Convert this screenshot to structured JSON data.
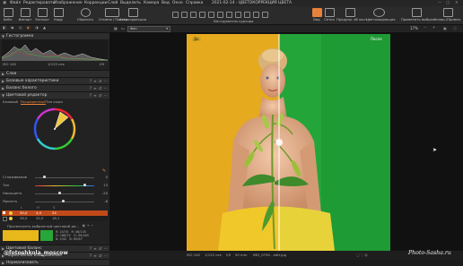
{
  "menubar": {
    "items": [
      "Файл",
      "Редактировать",
      "Изображение",
      "Коррекции",
      "Слой",
      "Выделить",
      "Камера",
      "Вид",
      "Окно",
      "Справка"
    ],
    "filename": "2021-02-14 - ЦВЕТОКОРРЕКЦИЯ ЦВЕТА"
  },
  "toolbar": {
    "left_buttons": [
      "Библ.",
      "Импорт",
      "Экспорт",
      "Кадр"
    ],
    "reset_label": "Сбросить",
    "undo_redo_label": "Отмена / Повтор",
    "auto_label": "Автокоррекция",
    "cursor_tools_label": "Инструменты курсора",
    "right_buttons": [
      "Вид",
      "Сетка",
      "Предупр. об эксп.",
      "Цветокоррекция"
    ],
    "apply_label": "Применить выбран.",
    "copy_label": "Копир./Примен."
  },
  "left_panel": {
    "histogram_title": "Гистограмма",
    "exif": {
      "iso": "ISO 100",
      "shutter": "1/125 сек",
      "aperture": "f/9"
    },
    "sections": [
      "Слои",
      "Базовые характеристики",
      "Баланс белого",
      "Цветовой редактор"
    ],
    "color_editor_tabs": [
      "Базовый",
      "Расширенный",
      "Тон кожи"
    ],
    "active_tab": "Расширенный",
    "sliders": [
      {
        "label": "Сглаживание",
        "value": "0",
        "pos": 0.15
      },
      {
        "label": "Тон",
        "value": "13",
        "pos": 0.82
      },
      {
        "label": "Насыщенн.",
        "value": "-20",
        "pos": 0.4
      },
      {
        "label": "Яркость",
        "value": "-6",
        "pos": 0.45
      }
    ],
    "table_header": [
      "",
      "L",
      "H",
      "S",
      "L"
    ],
    "table_rows": [
      {
        "c1": "30,0",
        "c2": "4,0",
        "c3": "24"
      },
      {
        "c1": "36,0",
        "c2": "32,0",
        "c3": "18,1"
      }
    ],
    "preview_label": "Просмотреть выбранный цветовой ди...",
    "readout": {
      "l1": "R:",
      "l1v": "247/0",
      "l2": "G:",
      "l2v": "186/72",
      "l3": "B:",
      "l3v": "2/42",
      "r1": "R:",
      "r1v": "46/135",
      "r2": "G:",
      "r2v": "99/160",
      "r3": "B:",
      "r3v": "65/67"
    },
    "bottom_sections": [
      "Цветовой баланс",
      "Черно-белое изображение",
      "Нормализовать"
    ]
  },
  "view": {
    "zoom": "17%",
    "preset_selector": "Фон",
    "before_label": "До",
    "after_label": "После"
  },
  "bottom_bar": {
    "iso": "ISO 100",
    "shutter": "1/125 сек",
    "aperture": "f/9",
    "focal": "50 mm",
    "filename": "IMG_0790 - edit.jpg"
  },
  "watermark_left": "@fotoshkola_moscow",
  "watermark_right": "Photo-Sasha.ru",
  "colors": {
    "before_bg": "#e2a41b",
    "after_bg": "#23a43a",
    "accent": "#e8823a"
  }
}
